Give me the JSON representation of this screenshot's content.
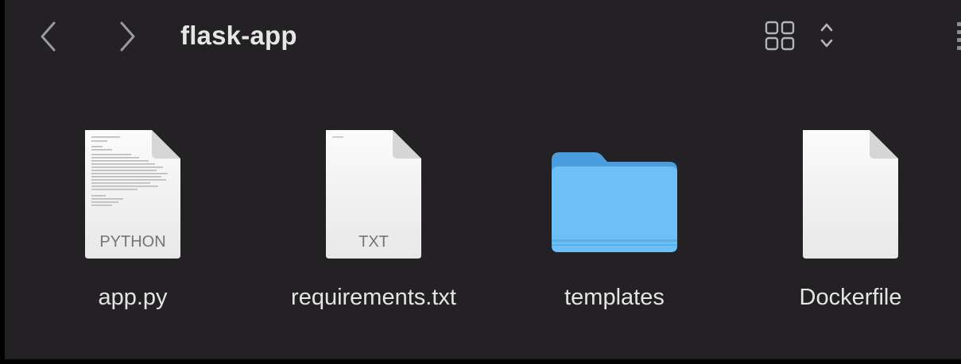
{
  "window": {
    "title": "flask-app"
  },
  "toolbar": {
    "back_icon": "chevron-left-icon",
    "forward_icon": "chevron-right-icon",
    "view_icon": "icon-grid-view-icon",
    "view_chevrons_icon": "up-down-chevron-icon"
  },
  "files": [
    {
      "name": "app.py",
      "kind_label": "PYTHON",
      "icon": "python-document-icon"
    },
    {
      "name": "requirements.txt",
      "kind_label": "TXT",
      "icon": "text-document-icon"
    },
    {
      "name": "templates",
      "kind_label": "",
      "icon": "folder-icon",
      "color": "#5fb3f3"
    },
    {
      "name": "Dockerfile",
      "kind_label": "",
      "icon": "blank-document-icon"
    }
  ],
  "colors": {
    "background": "#232123",
    "text": "#e4e4e4",
    "folder": "#5fb3f3"
  }
}
